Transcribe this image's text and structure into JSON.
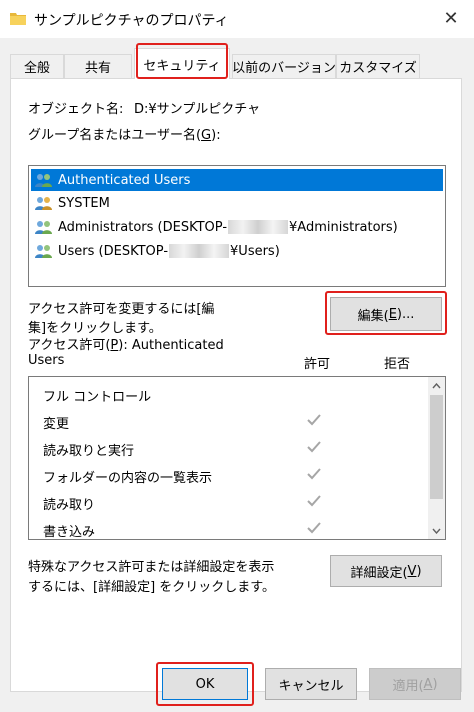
{
  "window": {
    "title": "サンプルピクチャのプロパティ",
    "close_glyph": "✕"
  },
  "tabs": [
    {
      "label": "全般"
    },
    {
      "label": "共有"
    },
    {
      "label": "セキュリティ"
    },
    {
      "label": "以前のバージョン"
    },
    {
      "label": "カスタマイズ"
    }
  ],
  "active_tab": "セキュリティ",
  "object": {
    "label": "オブジェクト名:",
    "value": "D:¥サンプルピクチャ"
  },
  "group_list": {
    "label": "グループ名またはユーザー名(",
    "access_key": "G",
    "label_suffix": "):",
    "items": [
      {
        "text": "Authenticated Users",
        "selected": true,
        "icon": "user-group-icon"
      },
      {
        "text": "SYSTEM",
        "selected": false,
        "icon": "user-group-icon"
      },
      {
        "prefix": "Administrators (DESKTOP-",
        "suffix": "¥Administrators)",
        "selected": false,
        "icon": "user-group-icon"
      },
      {
        "prefix": "Users (DESKTOP-",
        "suffix": "¥Users)",
        "selected": false,
        "icon": "user-group-icon"
      }
    ]
  },
  "change_text": {
    "line1": "アクセス許可を変更するには[編",
    "line2": "集]をクリックします。"
  },
  "edit_button": {
    "label_pre": "編集(",
    "access_key": "E",
    "label_post": ")..."
  },
  "permissions": {
    "heading_pre": "アクセス許可(",
    "heading_key": "P",
    "heading_post": "): Authenticated",
    "heading_line2": "Users",
    "allow_header": "許可",
    "deny_header": "拒否",
    "rows": [
      {
        "name": "フル コントロール",
        "allow": false,
        "deny": false
      },
      {
        "name": "変更",
        "allow": true,
        "deny": false
      },
      {
        "name": "読み取りと実行",
        "allow": true,
        "deny": false
      },
      {
        "name": "フォルダーの内容の一覧表示",
        "allow": true,
        "deny": false
      },
      {
        "name": "読み取り",
        "allow": true,
        "deny": false
      },
      {
        "name": "書き込み",
        "allow": true,
        "deny": false
      }
    ]
  },
  "advanced": {
    "text_line1": "特殊なアクセス許可または詳細設定を表示",
    "text_line2": "するには、[詳細設定] をクリックします。",
    "button_pre": "詳細設定(",
    "button_key": "V",
    "button_post": ")"
  },
  "footer": {
    "ok": "OK",
    "cancel": "キャンセル",
    "apply_pre": "適用(",
    "apply_key": "A",
    "apply_post": ")"
  },
  "colors": {
    "highlight": "#e0201c",
    "selection": "#0078d7",
    "dialog_bg": "#f0f0f0"
  }
}
